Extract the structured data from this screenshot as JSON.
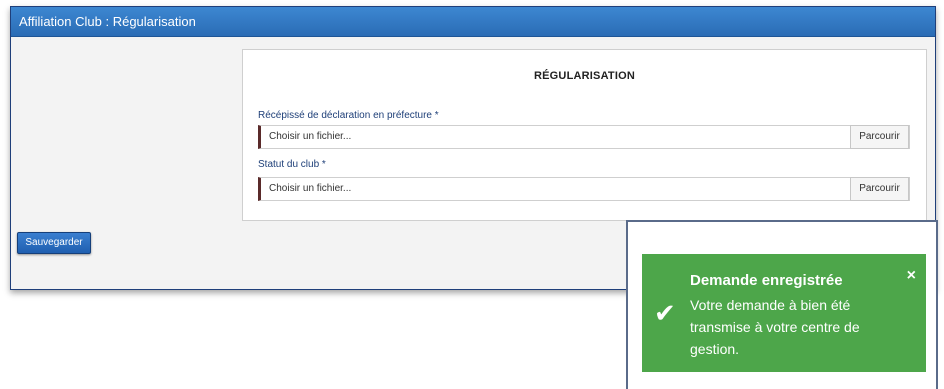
{
  "window": {
    "title": "Affiliation Club : Régularisation"
  },
  "form": {
    "title": "RÉGULARISATION",
    "fields": [
      {
        "label": "Récépissé de déclaration en préfecture *",
        "placeholder": "Choisir un fichier...",
        "button": "Parcourir"
      },
      {
        "label": "Statut du club *",
        "placeholder": "Choisir un fichier...",
        "button": "Parcourir"
      }
    ]
  },
  "actions": {
    "save_label": "Sauvegarder"
  },
  "toast": {
    "title": "Demande enregistrée",
    "message": "Votre demande à bien été transmise à votre centre de gestion.",
    "close": "×",
    "check": "✔",
    "color": "#4da64a"
  }
}
